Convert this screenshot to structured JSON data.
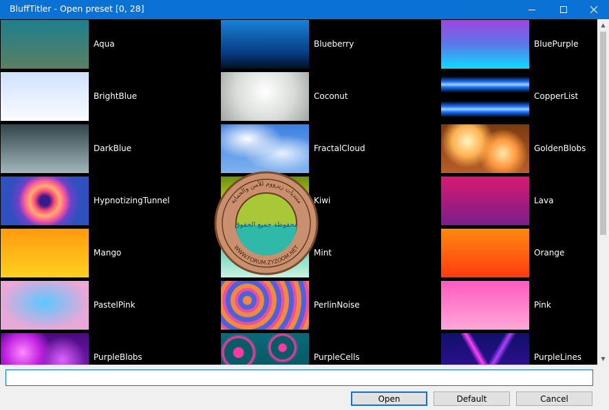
{
  "window": {
    "title": "BluffTitler - Open preset [0, 28]"
  },
  "presets": [
    {
      "label": "Aqua",
      "bg": "linear-gradient(#1e7f8e,#5a7f62)"
    },
    {
      "label": "Blueberry",
      "bg": "linear-gradient(#1a82d8,#063a80 70%,#02101f)"
    },
    {
      "label": "BluePurple",
      "bg": "linear-gradient(#a044e0,#5a78e8 50%,#0edcff)"
    },
    {
      "label": "BrightBlue",
      "bg": "linear-gradient(#cfe0ff,#fbfdff)"
    },
    {
      "label": "Coconut",
      "bg": "radial-gradient(circle at 50% 40%,#ffffff,#d8dcd8 55%,#9fa5a2)"
    },
    {
      "label": "CopperList",
      "bg": "repeating-linear-gradient(#000 0,#000 6px,#1a70ff 14px,#9fd3ff 18px,#1a70ff 22px,#000 30px,#000 36px)"
    },
    {
      "label": "DarkBlue",
      "bg": "linear-gradient(#33454a,#9fb7bb)"
    },
    {
      "label": "FractalCloud",
      "bg": "radial-gradient(ellipse at 30% 30%,#ffffff,transparent 40%),radial-gradient(ellipse at 70% 60%,#e8f1ff,transparent 45%),linear-gradient(#3d7fe0,#7fb2f0)"
    },
    {
      "label": "GoldenBlobs",
      "bg": "radial-gradient(circle at 30% 35%,#fff5c0,#ffb050 22%,transparent 38%),radial-gradient(circle at 70% 60%,#ffe8a8,#ff9a40 20%,transparent 36%),linear-gradient(#7a3a10,#b85e28)"
    },
    {
      "label": "HypnotizingTunnel",
      "bg": "radial-gradient(circle at 50% 50%,#3a1a8a 0,#3a1a8a 10%,#ff4d7a 20%,#ffb070 30%,#ff5a9a 40%,#7040c8 52%,#3050c0 70%)"
    },
    {
      "label": "Kiwi",
      "bg": "linear-gradient(#6a8f10,#b8c020 45%,#6b8f15)"
    },
    {
      "label": "Lava",
      "bg": "linear-gradient(#d81a70,#7a1e8a)"
    },
    {
      "label": "Mango",
      "bg": "linear-gradient(#ff9a10,#ffd020)"
    },
    {
      "label": "Mint",
      "bg": "linear-gradient(#28b5a8,#c8f5e0)"
    },
    {
      "label": "Orange",
      "bg": "linear-gradient(#ff8a10,#ff3a10)"
    },
    {
      "label": "PastelPink",
      "bg": "radial-gradient(ellipse at 50% 45%,#5ac8ff,#e8a8d8 70%)"
    },
    {
      "label": "PerlinNoise",
      "bg": "repeating-radial-gradient(circle at 30% 40%,#f08a40 0,#f08a40 6px,#5060d8 7px,#5060d8 13px,#e850a0 14px,#e850a0 18px)"
    },
    {
      "label": "Pink",
      "bg": "linear-gradient(#ff5ac0,#ffa8d8)"
    },
    {
      "label": "PurpleBlobs",
      "bg": "radial-gradient(circle at 25% 40%,#ff8aff,#c020e0 25%,transparent 40%),radial-gradient(circle at 70% 55%,#e060ff,transparent 35%),linear-gradient(#4a0a80,#8020c0)"
    },
    {
      "label": "PurpleCells",
      "bg": "radial-gradient(circle at 20% 40%,#ff3aa0 0,#ff3aa0 6%,#0a5a6a 8%,#0a5a6a 18%,#ff3aa0 20%,transparent 24%),radial-gradient(circle at 70% 30%,#ff3aa0 0,#ff3aa0 5%,#0a5a6a 7%,#0a5a6a 16%,#ff3aa0 18%,transparent 22%),linear-gradient(#0a6a7a,#08505c)"
    },
    {
      "label": "PurpleLines",
      "bg": "linear-gradient(60deg,transparent 40%,#ff40ff 45%,transparent 50%),linear-gradient(120deg,transparent 55%,#b040ff 60%,transparent 65%),linear-gradient(#10106a,#3a10a0)"
    }
  ],
  "preset_name_input": {
    "value": ""
  },
  "buttons": {
    "open": "Open",
    "default": "Default",
    "cancel": "Cancel"
  },
  "watermark": {
    "ring_text": "منتديات زيزووم للأمن والحماية",
    "center_text": "محفوظة جميع الحقوق",
    "bottom_text": "WWW.FORUM.ZYZOOM.NET"
  }
}
